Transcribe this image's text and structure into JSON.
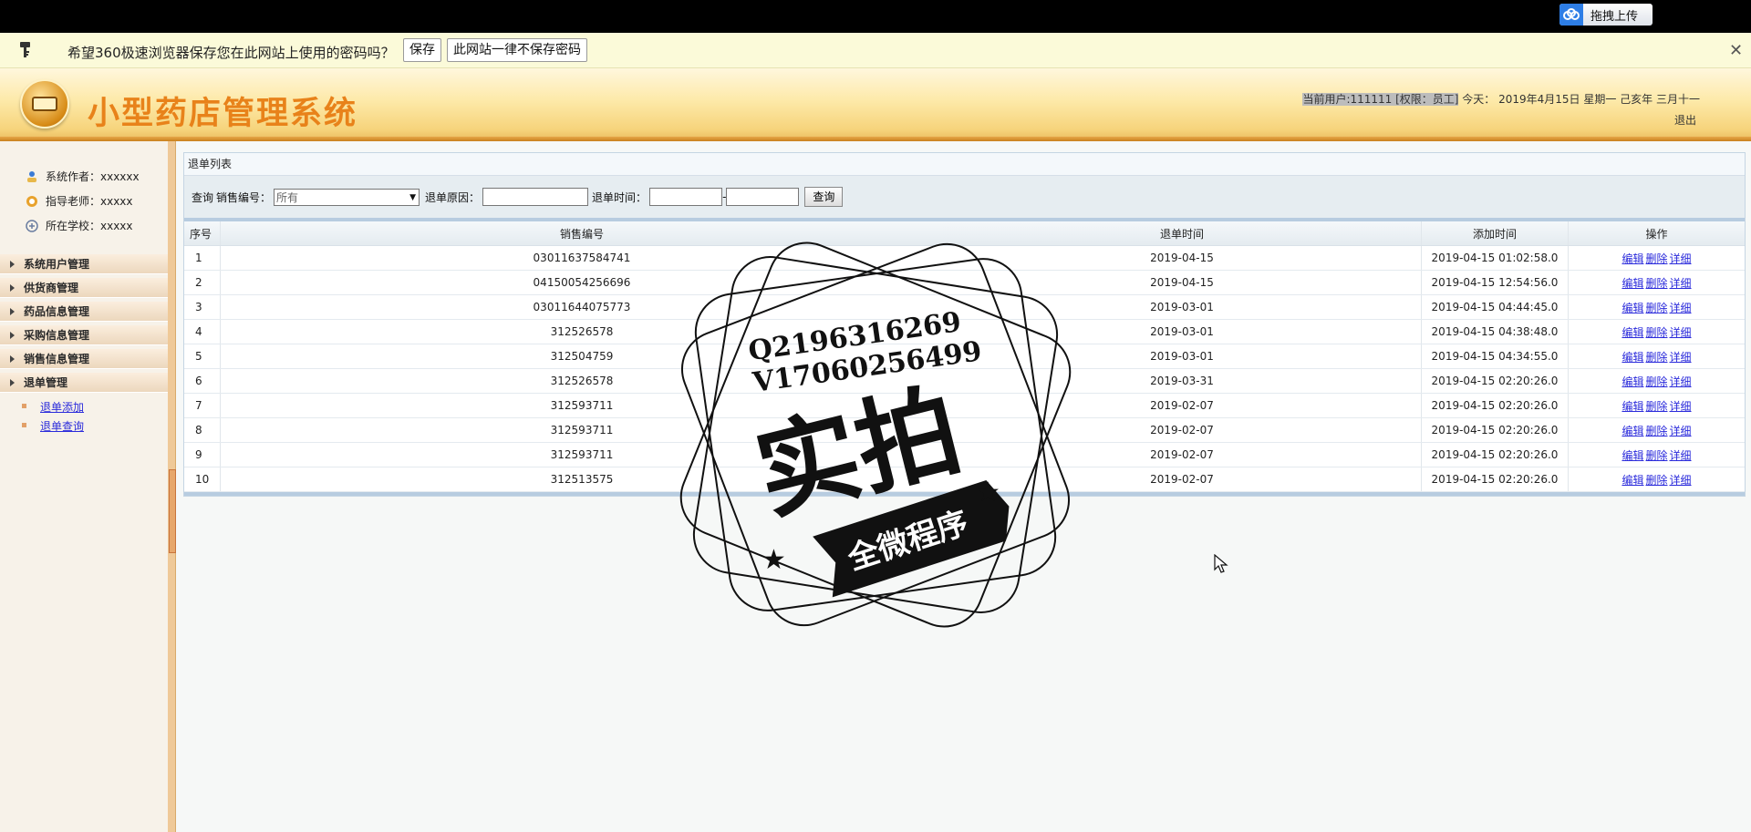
{
  "browser": {
    "upload_button": "拖拽上传",
    "password_prompt": "希望360极速浏览器保存您在此网站上使用的密码吗？",
    "save_button": "保存",
    "never_button": "此网站一律不保存密码",
    "close_symbol": "✕"
  },
  "header": {
    "title": "小型药店管理系统",
    "user_info": "当前用户:111111 [权限：员工]",
    "today": "今天： 2019年4月15日 星期一 己亥年 三月十一",
    "logout": "退出"
  },
  "sidebar": {
    "author": "系统作者：xxxxxx",
    "teacher": "指导老师：xxxxx",
    "school": "所在学校：xxxxx",
    "menu": [
      "系统用户管理",
      "供货商管理",
      "药品信息管理",
      "采购信息管理",
      "销售信息管理",
      "退单管理"
    ],
    "submenu": [
      "退单添加",
      "退单查询"
    ]
  },
  "panel": {
    "title": "退单列表",
    "filter": {
      "query_label": "查询",
      "sales_no_label": "销售编号：",
      "sales_no_selected": "所有",
      "reason_label": "退单原因：",
      "time_label": "退单时间：",
      "range_sep": "-",
      "query_button": "查询"
    },
    "columns": [
      "序号",
      "销售编号",
      "退单时间",
      "添加时间",
      "操作"
    ],
    "ops": [
      "编辑",
      "删除",
      "详细"
    ],
    "rows": [
      {
        "no": "1",
        "sales_no": "03011637584741",
        "return_time": "2019-04-15",
        "added_time": "2019-04-15 01:02:58.0"
      },
      {
        "no": "2",
        "sales_no": "04150054256696",
        "return_time": "2019-04-15",
        "added_time": "2019-04-15 12:54:56.0"
      },
      {
        "no": "3",
        "sales_no": "03011644075773",
        "return_time": "2019-03-01",
        "added_time": "2019-04-15 04:44:45.0"
      },
      {
        "no": "4",
        "sales_no": "312526578",
        "return_time": "2019-03-01",
        "added_time": "2019-04-15 04:38:48.0"
      },
      {
        "no": "5",
        "sales_no": "312504759",
        "return_time": "2019-03-01",
        "added_time": "2019-04-15 04:34:55.0"
      },
      {
        "no": "6",
        "sales_no": "312526578",
        "return_time": "2019-03-31",
        "added_time": "2019-04-15 02:20:26.0"
      },
      {
        "no": "7",
        "sales_no": "312593711",
        "return_time": "2019-02-07",
        "added_time": "2019-04-15 02:20:26.0"
      },
      {
        "no": "8",
        "sales_no": "312593711",
        "return_time": "2019-02-07",
        "added_time": "2019-04-15 02:20:26.0"
      },
      {
        "no": "9",
        "sales_no": "312593711",
        "return_time": "2019-02-07",
        "added_time": "2019-04-15 02:20:26.0"
      },
      {
        "no": "10",
        "sales_no": "312513575",
        "return_time": "2019-02-07",
        "added_time": "2019-04-15 02:20:26.0"
      }
    ]
  },
  "watermark": {
    "line1": "Q2196316269",
    "line2": "V17060256499",
    "big": "实拍",
    "ribbon": "全微程序"
  }
}
